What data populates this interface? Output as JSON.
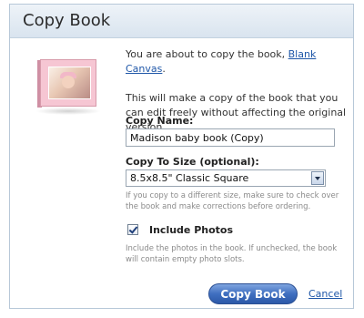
{
  "dialog": {
    "title": "Copy Book",
    "intro_prefix": "You are about to copy the book, ",
    "intro_link": "Blank Canvas",
    "intro_suffix": ".",
    "intro_detail": "This will make a copy of the book that you can edit freely without affecting the original version."
  },
  "form": {
    "name_label": "Copy Name:",
    "name_value": "Madison baby book (Copy)",
    "size_label": "Copy To Size (optional):",
    "size_value": "8.5x8.5\" Classic Square",
    "size_hint": "If you copy to a different size, make sure to check over the book and make corrections before ordering.",
    "include_photos_label": "Include Photos",
    "include_photos_checked": true,
    "photos_hint": "Include the photos in the book. If unchecked, the book will contain empty photo slots."
  },
  "actions": {
    "copy_label": "Copy Book",
    "cancel_label": "Cancel"
  },
  "colors": {
    "accent": "#3f6fc0",
    "link": "#1f57a8",
    "titlebar": "#d9e4ef",
    "cover": "#f6c6d3"
  }
}
